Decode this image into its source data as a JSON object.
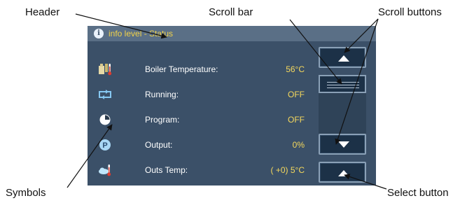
{
  "callouts": {
    "header": "Header",
    "scroll_bar": "Scroll bar",
    "scroll_buttons": "Scroll buttons",
    "symbols": "Symbols",
    "select_button": "Select button"
  },
  "panel": {
    "header": {
      "icon": "info-icon",
      "text": "info level - Status"
    },
    "rows": [
      {
        "icon": "boiler-thermometer-icon",
        "label": "Boiler Temperature:",
        "value": "56°C"
      },
      {
        "icon": "running-arrows-icon",
        "label": "Running:",
        "value": "OFF"
      },
      {
        "icon": "program-clock-icon",
        "label": "Program:",
        "value": "OFF"
      },
      {
        "icon": "output-p-icon",
        "label": "Output:",
        "value": "0%"
      },
      {
        "icon": "outdoor-thermometer-icon",
        "label": "Outs Temp:",
        "value": "( +0)  5°C"
      }
    ]
  },
  "colors": {
    "panel_bg": "#3b5068",
    "header_bg": "#5a6f86",
    "value_text": "#f5d85c",
    "header_text": "#f1d24a",
    "button_bg": "#1c3147"
  }
}
